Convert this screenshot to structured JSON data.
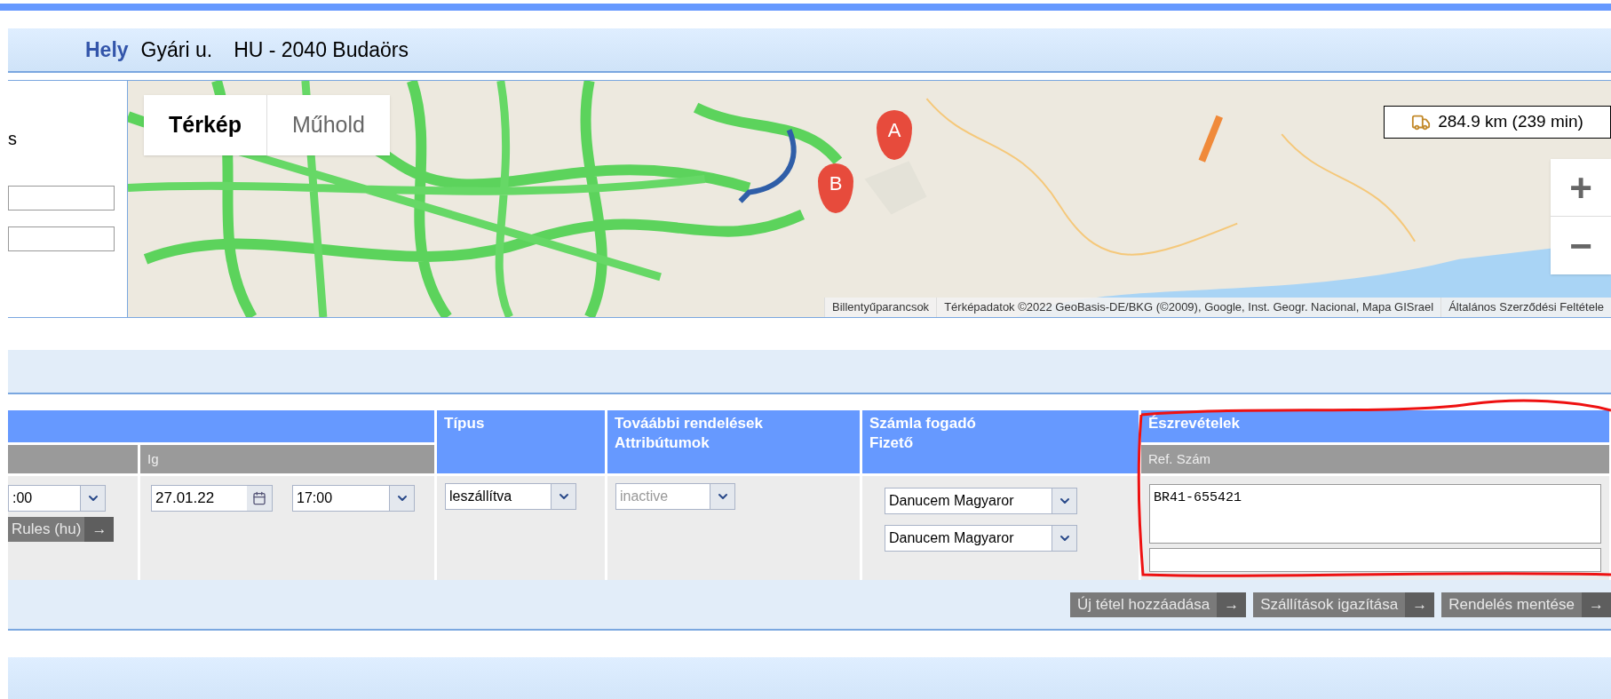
{
  "location_bar": {
    "label": "Hely",
    "street": "Gyári u.",
    "city": "HU - 2040 Budaörs"
  },
  "left_panel": {
    "text": "s"
  },
  "map": {
    "map_types": [
      {
        "label": "Térkép",
        "selected": true
      },
      {
        "label": "Műhold",
        "selected": false
      }
    ],
    "markers": [
      {
        "label": "A"
      },
      {
        "label": "B"
      }
    ],
    "distance": "284.9 km (239 min)",
    "zoom_buttons": [
      "+",
      "−"
    ],
    "attribution": [
      "Billentyűparancsok",
      "Térképadatok ©2022 GeoBasis-DE/BKG (©2009), Google, Inst. Geogr. Nacional, Mapa GISrael",
      "Általános Szerződési Feltétele"
    ]
  },
  "order_table": {
    "headers": [
      {
        "title": "Típus"
      },
      {
        "title": "Továábbi rendelések",
        "subtitle": "Attribútumok"
      },
      {
        "title": "Számla fogadó",
        "subtitle": "Fizető"
      },
      {
        "title": "Észrevételek",
        "subtitle": "Ref. Szám"
      }
    ],
    "sub_headers": [
      "Ig"
    ],
    "from_time": ":00",
    "rules_button": "Rules (hu)",
    "arrow": "→",
    "to_date": "27.01.22",
    "to_time": "17:00",
    "type_value": "leszállítva",
    "attribute_value": {
      "value": "inactive",
      "disabled": true
    },
    "payer_values": [
      "Danucem Magyaror",
      "Danucem Magyaror"
    ],
    "remarks": "BR41-655421"
  },
  "actions": [
    {
      "label": "Új tétel hozzáadása",
      "arrow": "→"
    },
    {
      "label": "Szállítások igazítása",
      "arrow": "→"
    },
    {
      "label": "Rendelés mentése",
      "arrow": "→"
    }
  ]
}
